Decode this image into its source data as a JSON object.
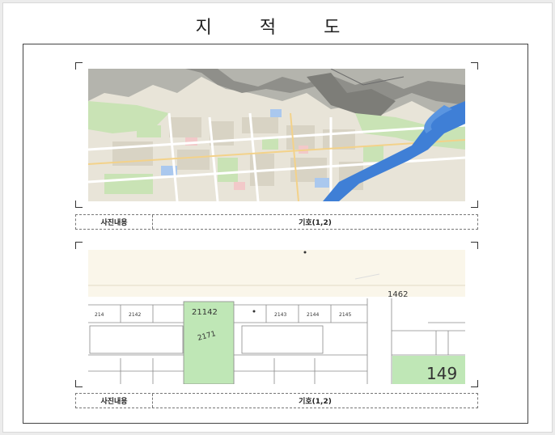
{
  "page": {
    "title": "지 적 도"
  },
  "photos": [
    {
      "caption_label": "사진내용",
      "caption_value": "기호(1,2)",
      "kind": "aerial-map"
    },
    {
      "caption_label": "사진내용",
      "caption_value": "기호(1,2)",
      "kind": "cadastral-map",
      "lot_numbers": [
        "21142",
        "2171",
        "1462",
        "149",
        "214",
        "2142",
        "2143",
        "2144",
        "2145"
      ]
    }
  ],
  "colors": {
    "frame": "#444444",
    "map_urban": "#e8e4d8",
    "map_green": "#c9e3b5",
    "map_water": "#3f7fd6",
    "map_mountain": "#9a9a9a",
    "parcel_green": "#bfe7b6",
    "parcel_bg": "#faf6ea"
  }
}
